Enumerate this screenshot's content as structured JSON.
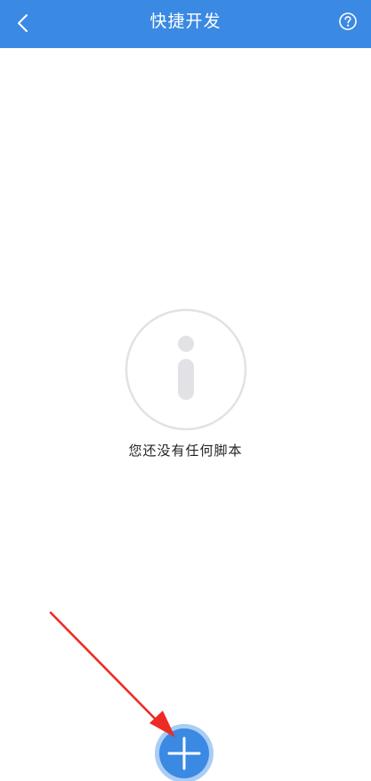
{
  "header": {
    "title": "快捷开发",
    "back_icon": "chevron-left-icon",
    "help_icon": "help-circle-icon"
  },
  "empty_state": {
    "icon": "info-icon",
    "message": "您还没有任何脚本"
  },
  "fab": {
    "icon": "plus-icon"
  },
  "annotation": {
    "icon": "red-arrow-icon"
  },
  "colors": {
    "primary": "#3a89e3",
    "fab_ring": "#a9cdf4",
    "annotation_red": "#ee2a24",
    "icon_gray": "#e2e2e6"
  }
}
